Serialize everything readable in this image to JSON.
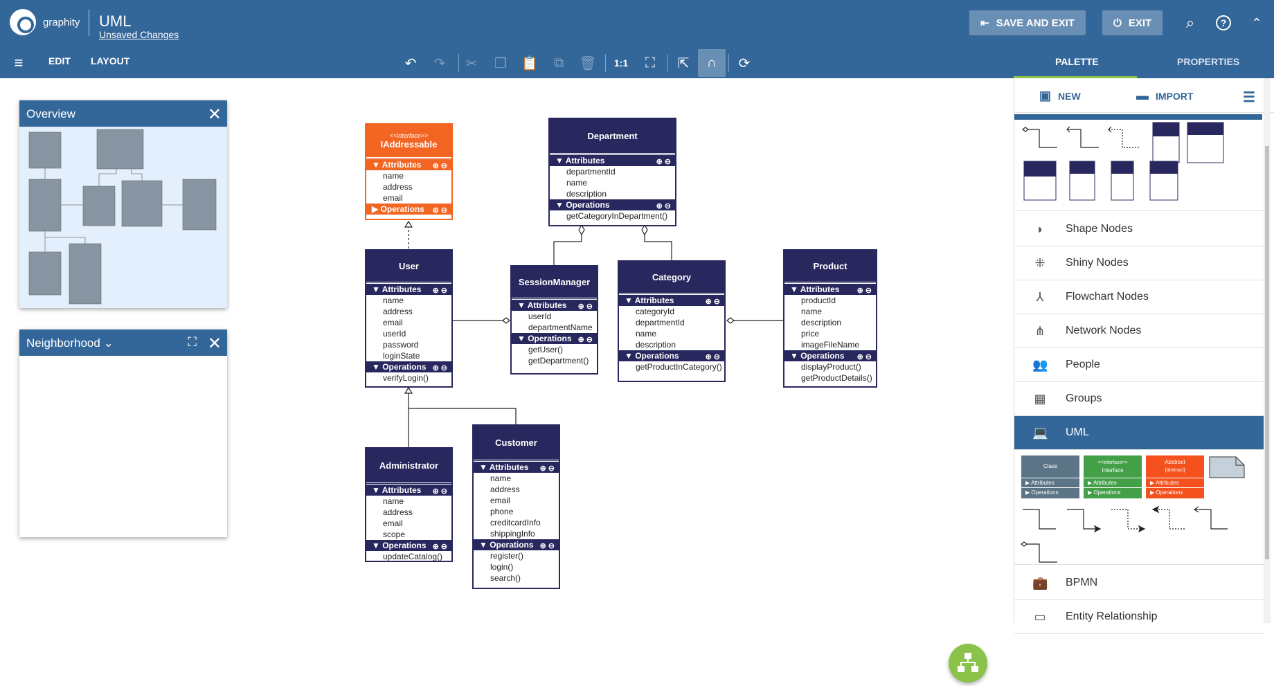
{
  "header": {
    "brand": "graphity",
    "title": "UML",
    "unsaved": "Unsaved Changes",
    "save_exit": "SAVE AND EXIT",
    "exit": "EXIT"
  },
  "menu": {
    "edit": "EDIT",
    "layout": "LAYOUT",
    "zoom": "1:1"
  },
  "right_tabs": {
    "palette": "PALETTE",
    "properties": "PROPERTIES"
  },
  "palette_tools": {
    "new": "NEW",
    "import": "IMPORT"
  },
  "overview": {
    "title": "Overview"
  },
  "neighborhood": {
    "title": "Neighborhood"
  },
  "categories": [
    "Shape Nodes",
    "Shiny Nodes",
    "Flowchart Nodes",
    "Network Nodes",
    "People",
    "Groups",
    "UML",
    "BPMN",
    "Entity Relationship"
  ],
  "uml_palette": {
    "class": "Class",
    "interface": "Interface",
    "interface_stereo": "<<interface>>",
    "abstract": "Abstract",
    "abstract_stereo": "{abstract}",
    "attributes": "Attributes",
    "operations": "Operations"
  },
  "nodes": {
    "iaddressable": {
      "stereo": "<<interface>>",
      "name": "IAddressable",
      "attributes": [
        "name",
        "address",
        "email"
      ],
      "operations": []
    },
    "department": {
      "name": "Department",
      "attributes": [
        "departmentId",
        "name",
        "description"
      ],
      "operations": [
        "getCategoryInDepartment()"
      ]
    },
    "user": {
      "name": "User",
      "attributes": [
        "name",
        "address",
        "email",
        "userId",
        "password",
        "loginState"
      ],
      "operations": [
        "verifyLogin()"
      ]
    },
    "session": {
      "name": "SessionManager",
      "attributes": [
        "userId",
        "departmentName"
      ],
      "operations": [
        "getUser()",
        "getDepartment()"
      ]
    },
    "category": {
      "name": "Category",
      "attributes": [
        "categoryId",
        "departmentId",
        "name",
        "description"
      ],
      "operations": [
        "getProductInCategory()"
      ]
    },
    "product": {
      "name": "Product",
      "attributes": [
        "productId",
        "name",
        "description",
        "price",
        "imageFileName"
      ],
      "operations": [
        "displayProduct()",
        "getProductDetails()"
      ]
    },
    "administrator": {
      "name": "Administrator",
      "attributes": [
        "name",
        "address",
        "email",
        "scope"
      ],
      "operations": [
        "updateCatalog()"
      ]
    },
    "customer": {
      "name": "Customer",
      "attributes": [
        "name",
        "address",
        "email",
        "phone",
        "creditcardInfo",
        "shippingInfo"
      ],
      "operations": [
        "register()",
        "login()",
        "search()"
      ]
    }
  },
  "section_labels": {
    "attributes": "Attributes",
    "operations": "Operations"
  }
}
